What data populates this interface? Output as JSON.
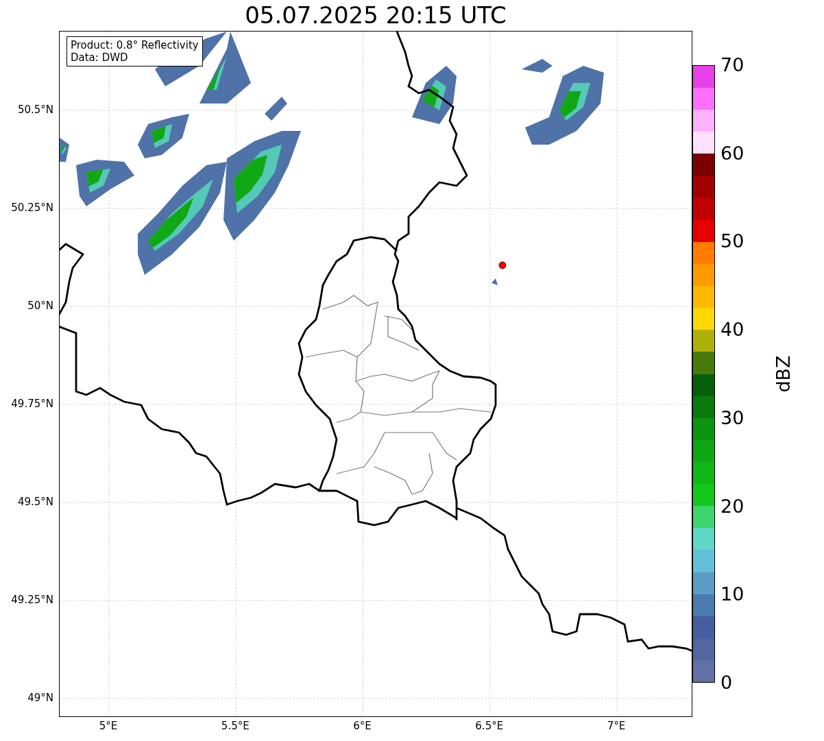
{
  "title": "05.07.2025 20:15 UTC",
  "map": {
    "legend": [
      "Product: 0.8° Reflectivity",
      "Data: DWD"
    ],
    "yticks": [
      "50.5°N",
      "50.25°N",
      "50°N",
      "49.75°N",
      "49.5°N",
      "49.25°N",
      "49°N"
    ],
    "xticks": [
      "5°E",
      "5.5°E",
      "6°E",
      "6.5°E",
      "7°E"
    ]
  },
  "colorbar": {
    "label": "dBZ",
    "ticks": [
      "70",
      "60",
      "50",
      "40",
      "30",
      "20",
      "10",
      "0"
    ],
    "segments": [
      {
        "color": "#e840e8"
      },
      {
        "color": "#ff70ff"
      },
      {
        "color": "#ffb0ff"
      },
      {
        "color": "#ffe0ff"
      },
      {
        "color": "#7a0000"
      },
      {
        "color": "#a20000"
      },
      {
        "color": "#c00000"
      },
      {
        "color": "#e60000"
      },
      {
        "color": "#ff7c00"
      },
      {
        "color": "#ff9900"
      },
      {
        "color": "#ffb800"
      },
      {
        "color": "#fed800"
      },
      {
        "color": "#b0b00a"
      },
      {
        "color": "#487a0a"
      },
      {
        "color": "#075e0a"
      },
      {
        "color": "#0a7a0e"
      },
      {
        "color": "#0c9310"
      },
      {
        "color": "#0ea613"
      },
      {
        "color": "#10b816"
      },
      {
        "color": "#12c81a"
      },
      {
        "color": "#3ed46e"
      },
      {
        "color": "#5fd7c5"
      },
      {
        "color": "#62c0da"
      },
      {
        "color": "#5b9cc4"
      },
      {
        "color": "#4a7ab0"
      },
      {
        "color": "#445ea0"
      },
      {
        "color": "#5267a1"
      },
      {
        "color": "#6270a6"
      }
    ]
  }
}
